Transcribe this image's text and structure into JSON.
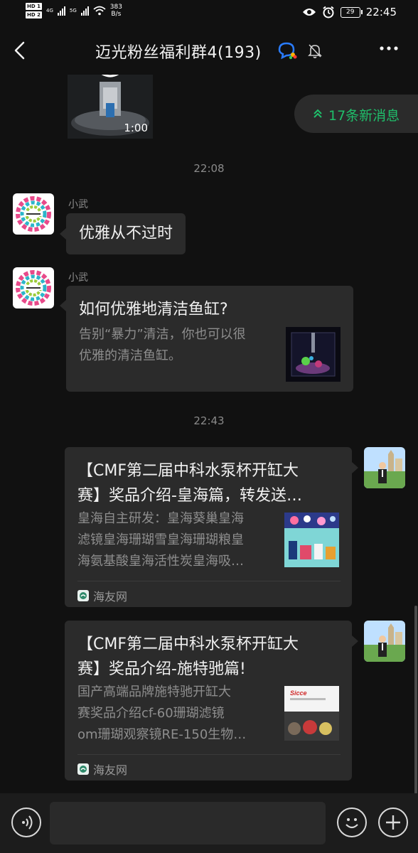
{
  "status_bar": {
    "hd1": "HD 1",
    "hd2": "HD 2",
    "net1": "4G",
    "net2": "5G",
    "speed_value": "383",
    "speed_unit": "B/s",
    "battery": "29",
    "time": "22:45"
  },
  "header": {
    "title": "迈光粉丝福利群4(193)"
  },
  "new_messages": {
    "label": "17条新消息"
  },
  "video": {
    "duration": "1:00"
  },
  "messages": [
    {
      "time": "22:08"
    },
    {
      "sender": "小武",
      "text": "优雅从不过时"
    },
    {
      "sender": "小武",
      "title": "如何优雅地清洁鱼缸?",
      "desc_line1": "告别“暴力”清洁，你也可以很",
      "desc_line2": "优雅的清洁鱼缸。"
    },
    {
      "time": "22:43"
    },
    {
      "title_line1": "【CMF第二届中科水泵杯开缸大",
      "title_line2": "赛】奖品介绍-皇海篇，转发送…",
      "desc_line1": "皇海自主研发：皇海葵巢皇海",
      "desc_line2": "滤镜皇海珊瑚雪皇海珊瑚粮皇",
      "desc_line3": "海氨基酸皇海活性炭皇海吸…",
      "source": "海友网"
    },
    {
      "title_line1": "【CMF第二届中科水泵杯开缸大",
      "title_line2": "赛】奖品介绍-施特驰篇!",
      "desc_line1": "国产高端品牌施特驰开缸大",
      "desc_line2": "赛奖品介绍cf-60珊瑚滤镜",
      "desc_line3": "om珊瑚观察镜RE-150生物…",
      "source": "海友网",
      "thumb_brand": "Sicce"
    }
  ],
  "colors": {
    "background": "#111111",
    "bubble": "#2b2b2b",
    "accent_green": "#1fbf6b"
  },
  "icons": [
    "back-arrow-icon",
    "chat-group-icon",
    "mute-bell-icon",
    "more-icon",
    "voice-icon",
    "emoji-icon",
    "plus-icon"
  ]
}
